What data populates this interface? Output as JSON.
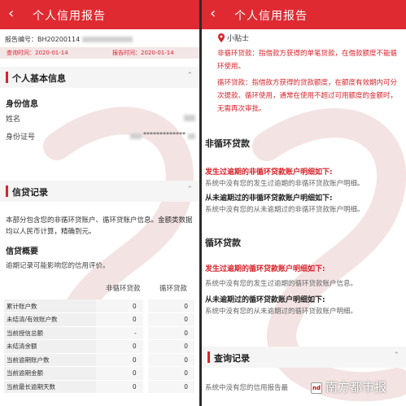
{
  "left": {
    "title": "个人信用报告",
    "report_id_label": "报告编号：BH20200114",
    "query_time_label": "查询时间：2020-01-14",
    "report_time_label": "报告时间：2020-01-14",
    "basic_section": "个人基本信息",
    "identity_heading": "身份信息",
    "name_label": "姓名",
    "id_label": "身份证号",
    "id_masked": "*************",
    "credit_section": "信贷记录",
    "credit_para": "本部分包含您的非循环贷账户、循环贷账户信息。金额类数据均以人民币计算，精确到元。",
    "overview_heading": "信贷概要",
    "overview_note": "逾期记录可能影响您的信用评价。",
    "col_nonrevolving": "非循环贷款",
    "col_revolving": "循环贷款",
    "rows": [
      {
        "name": "累计账户数",
        "a": "0",
        "b": "0"
      },
      {
        "name": "未结清/有效账户数",
        "a": "0",
        "b": "0"
      },
      {
        "name": "当前授信总额",
        "a": "-",
        "b": "0"
      },
      {
        "name": "未结清余额",
        "a": "0",
        "b": "0"
      },
      {
        "name": "当前逾期账户数",
        "a": "0",
        "b": "0"
      },
      {
        "name": "当前逾期金额",
        "a": "0",
        "b": "0"
      },
      {
        "name": "当前最长逾期天数",
        "a": "0",
        "b": "0"
      }
    ]
  },
  "right": {
    "title": "个人信用报告",
    "tip_title": "小贴士",
    "tip_nonrevolving": "非循环贷款：指借款方获得的单笔贷款，在借款额度不能循环使用。",
    "tip_revolving": "循环贷款：指借款方获得的贷款额度，在额度有效期内可分次提款、循环使用，通常在使用不超过可用额度的金额时，无需再次审批。",
    "nonrev_heading": "非循环贷款",
    "nonrev_overdue_red": "发生过逾期的非循环贷款账户明细如下:",
    "nonrev_overdue_grey": "系统中没有您的发生过逾期的非循环贷款账户明细。",
    "nonrev_clean_dark": "从未逾期过的非循环贷款账户明细如下:",
    "nonrev_clean_grey": "系统中没有您的从未逾期过的非循环贷款账户明细。",
    "rev_heading": "循环贷款",
    "rev_overdue_red": "发生过逾期的循环贷款账户明细如下:",
    "rev_overdue_grey": "系统中没有您的发生过逾期的循环贷款账户信息。",
    "rev_clean_dark": "从未逾期过的循环贷款账户明细如下:",
    "rev_clean_grey": "系统中没有您的从未逾期过的循环贷款账户明细。",
    "query_section": "查询记录",
    "query_text": "系统中没有您的信用报告最"
  },
  "watermark": {
    "logo_badge": "nd",
    "logo_text": "南方都市报"
  },
  "colors": {
    "accent": "#e02a31",
    "alert": "#d8232a"
  }
}
